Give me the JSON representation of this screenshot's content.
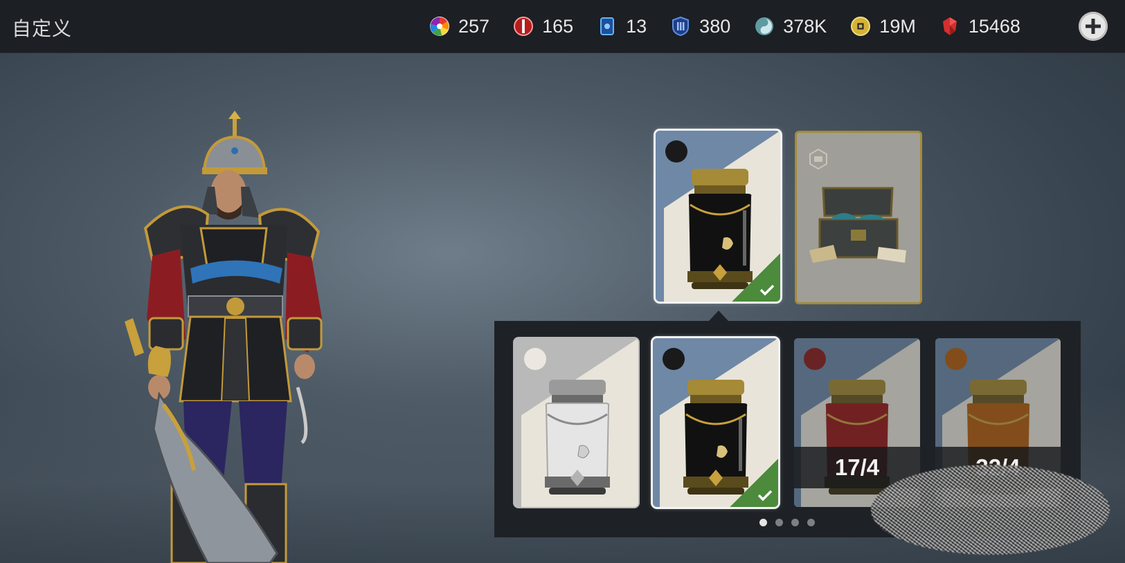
{
  "header": {
    "title": "自定义",
    "currencies": [
      {
        "icon": "multicolor-wheel-icon",
        "value": "257"
      },
      {
        "icon": "red-token-icon",
        "value": "165"
      },
      {
        "icon": "blue-card-icon",
        "value": "13"
      },
      {
        "icon": "blue-shield-icon",
        "value": "380"
      },
      {
        "icon": "teal-swirl-icon",
        "value": "378K"
      },
      {
        "icon": "gold-coin-icon",
        "value": "19M"
      },
      {
        "icon": "red-crystal-icon",
        "value": "15468"
      }
    ],
    "add_button_icon": "plus-icon"
  },
  "top_cards": [
    {
      "item": "black-jar",
      "color": "#1a1a1a",
      "selected": true,
      "equipped": true
    },
    {
      "item": "treasure-chest",
      "frame": "gold",
      "selected": false,
      "equipped": false
    }
  ],
  "variants": [
    {
      "item": "silver-jar",
      "color": "#e8e4de",
      "selected": false,
      "equipped": false,
      "count": null
    },
    {
      "item": "black-jar",
      "color": "#1a1a1a",
      "selected": true,
      "equipped": true,
      "count": null
    },
    {
      "item": "red-jar",
      "color": "#8e1e1e",
      "selected": false,
      "equipped": false,
      "count": "17/4"
    },
    {
      "item": "orange-jar",
      "color": "#b25e10",
      "selected": false,
      "equipped": false,
      "count": "32/4"
    }
  ],
  "pagination": {
    "pages": 4,
    "active": 1
  },
  "colors": {
    "topbar": "#1c1f23",
    "panel": "#1e2226",
    "equipped_green": "#4b8b3b",
    "card_blue": "#6e88a6",
    "card_gold": "#a58a37"
  }
}
